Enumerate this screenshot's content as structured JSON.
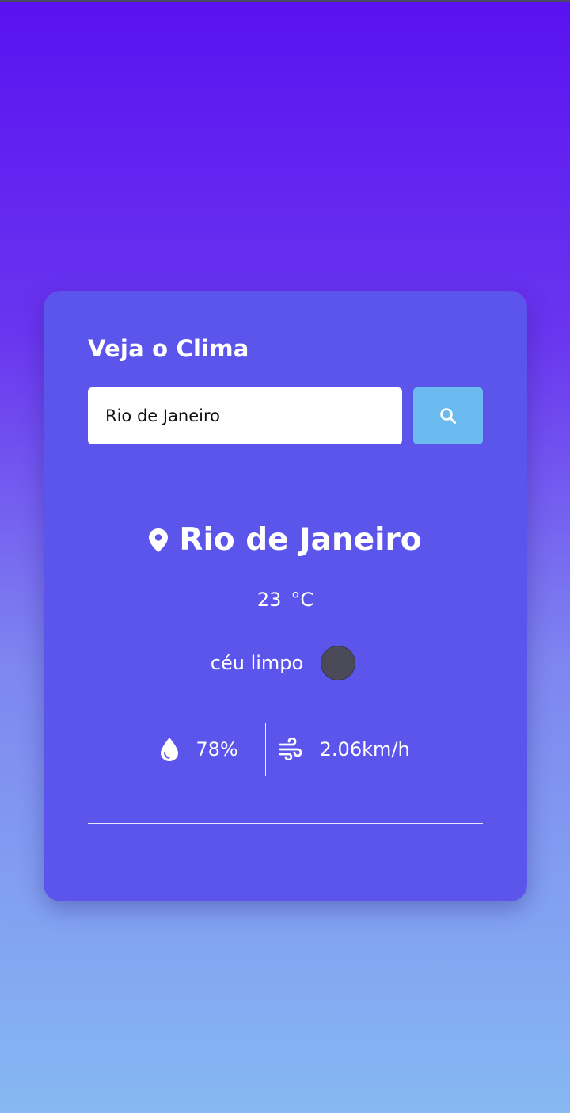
{
  "app": {
    "title": "Veja o Clima"
  },
  "search": {
    "value": "Rio de Janeiro",
    "placeholder": "",
    "button_icon": "search-icon"
  },
  "weather": {
    "city": "Rio de Janeiro",
    "location_icon": "map-pin-icon",
    "temperature": "23",
    "unit": "°C",
    "description": "céu limpo",
    "condition_icon": "weather-icon",
    "humidity": "78%",
    "humidity_icon": "droplet-icon",
    "wind": "2.06km/h",
    "wind_icon": "wind-icon"
  },
  "colors": {
    "card": "#5b55ec",
    "search_button": "#6bbaf0",
    "gradient_top": "#5a12f0",
    "gradient_bottom": "#86b8f2"
  }
}
